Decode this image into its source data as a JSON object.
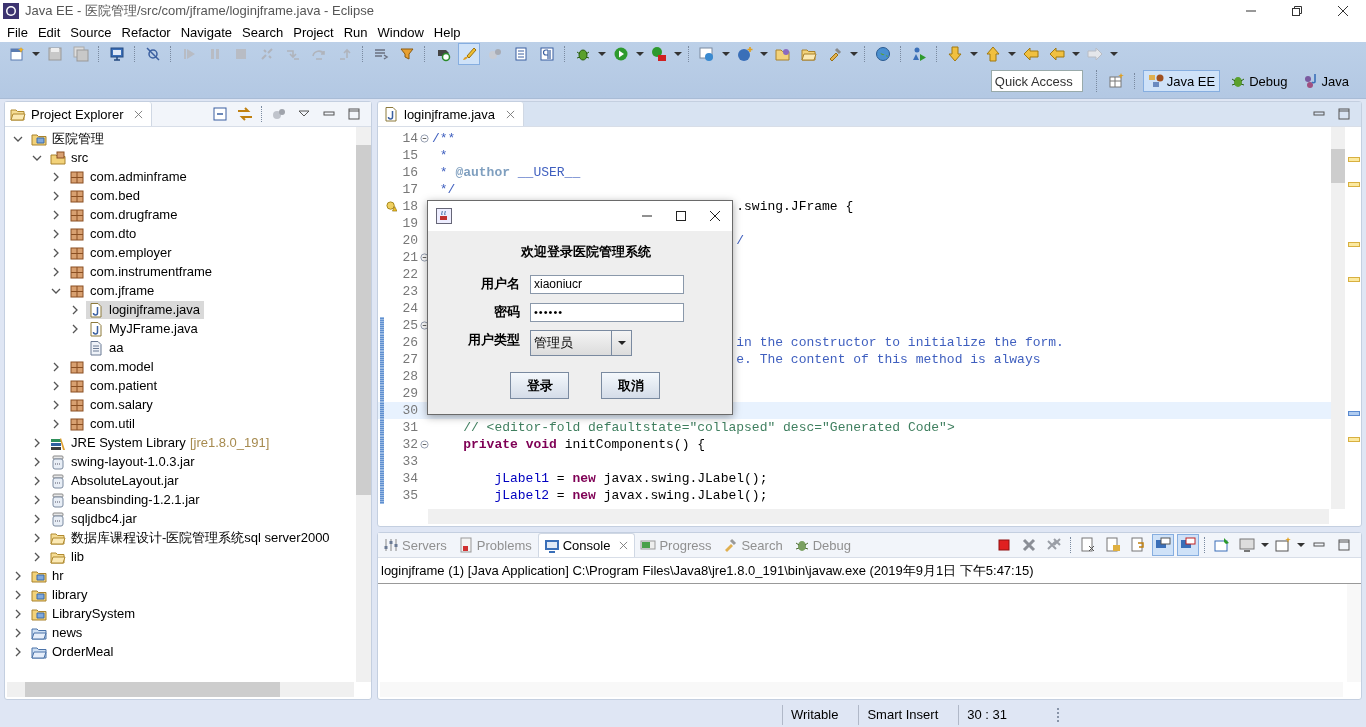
{
  "window": {
    "title": "Java EE - 医院管理/src/com/jframe/loginjframe.java - Eclipse"
  },
  "menu": [
    "File",
    "Edit",
    "Source",
    "Refactor",
    "Navigate",
    "Search",
    "Project",
    "Run",
    "Window",
    "Help"
  ],
  "main_toolbar": {
    "mark_occurrences": {
      "on": true
    }
  },
  "quick_access": {
    "placeholder": "Quick Access"
  },
  "perspectives": [
    {
      "label": "Java EE",
      "selected": true,
      "kind": "javaee"
    },
    {
      "label": "Debug",
      "selected": false,
      "kind": "debug"
    },
    {
      "label": "Java",
      "selected": false,
      "kind": "java"
    }
  ],
  "project_explorer": {
    "title": "Project Explorer",
    "tree": [
      {
        "label": "医院管理",
        "kind": "project",
        "expanded": true,
        "selected": false,
        "children": [
          {
            "label": "src",
            "kind": "source-folder",
            "expanded": true,
            "selected": false,
            "children": [
              {
                "label": "com.adminframe",
                "kind": "package",
                "expanded": false,
                "selected": false
              },
              {
                "label": "com.bed",
                "kind": "package",
                "expanded": false,
                "selected": false
              },
              {
                "label": "com.drugframe",
                "kind": "package",
                "expanded": false,
                "selected": false
              },
              {
                "label": "com.dto",
                "kind": "package",
                "expanded": false,
                "selected": false
              },
              {
                "label": "com.employer",
                "kind": "package",
                "expanded": false,
                "selected": false
              },
              {
                "label": "com.instrumentframe",
                "kind": "package",
                "expanded": false,
                "selected": false
              },
              {
                "label": "com.jframe",
                "kind": "package",
                "expanded": true,
                "selected": false,
                "children": [
                  {
                    "label": "loginjframe.java",
                    "kind": "java-file",
                    "expanded": false,
                    "selected": true
                  },
                  {
                    "label": "MyJFrame.java",
                    "kind": "java-file",
                    "expanded": false,
                    "selected": false
                  },
                  {
                    "label": "aa",
                    "kind": "text-file",
                    "selected": false
                  }
                ]
              },
              {
                "label": "com.model",
                "kind": "package",
                "expanded": false,
                "selected": false
              },
              {
                "label": "com.patient",
                "kind": "package",
                "expanded": false,
                "selected": false
              },
              {
                "label": "com.salary",
                "kind": "package",
                "expanded": false,
                "selected": false
              },
              {
                "label": "com.util",
                "kind": "package",
                "expanded": false,
                "selected": false
              }
            ]
          },
          {
            "label": "JRE System Library",
            "decoration": "[jre1.8.0_191]",
            "kind": "library",
            "expanded": false,
            "selected": false
          },
          {
            "label": "swing-layout-1.0.3.jar",
            "kind": "jar",
            "expanded": false,
            "selected": false
          },
          {
            "label": "AbsoluteLayout.jar",
            "kind": "jar",
            "expanded": false,
            "selected": false
          },
          {
            "label": "beansbinding-1.2.1.jar",
            "kind": "jar",
            "expanded": false,
            "selected": false
          },
          {
            "label": "sqljdbc4.jar",
            "kind": "jar",
            "expanded": false,
            "selected": false
          },
          {
            "label": "数据库课程设计-医院管理系统sql server2000",
            "kind": "folder",
            "expanded": false,
            "selected": false
          },
          {
            "label": "lib",
            "kind": "folder",
            "expanded": false,
            "selected": false
          }
        ]
      },
      {
        "label": "hr",
        "kind": "project",
        "expanded": false,
        "selected": false
      },
      {
        "label": "library",
        "kind": "project",
        "expanded": false,
        "selected": false
      },
      {
        "label": "LibrarySystem",
        "kind": "project",
        "expanded": false,
        "selected": false
      },
      {
        "label": "news",
        "kind": "folder-project",
        "expanded": false,
        "selected": false
      },
      {
        "label": "OrderMeal",
        "kind": "folder-project",
        "expanded": false,
        "selected": false
      }
    ]
  },
  "editor": {
    "tab": {
      "label": "loginjframe.java"
    },
    "lines": [
      {
        "number": "14",
        "fold": true,
        "changed": false,
        "current": false,
        "warning": false,
        "covered": false,
        "tokens": [
          {
            "text": "/**",
            "kind": "doc"
          }
        ]
      },
      {
        "number": "15",
        "fold": false,
        "changed": false,
        "current": false,
        "warning": false,
        "covered": false,
        "tokens": [
          {
            "text": " *",
            "kind": "doc"
          }
        ]
      },
      {
        "number": "16",
        "fold": false,
        "changed": false,
        "current": false,
        "warning": false,
        "covered": false,
        "tokens": [
          {
            "text": " * ",
            "kind": "doc"
          },
          {
            "text": "@author",
            "kind": "doctag"
          },
          {
            "text": " __USER__",
            "kind": "doc"
          }
        ]
      },
      {
        "number": "17",
        "fold": false,
        "changed": false,
        "current": false,
        "warning": false,
        "covered": false,
        "tokens": [
          {
            "text": " */",
            "kind": "doc"
          }
        ]
      },
      {
        "number": "18",
        "fold": false,
        "changed": false,
        "current": false,
        "warning": true,
        "covered": true,
        "tokens": [
          {
            "text": ".swing.JFrame {",
            "kind": "plain"
          }
        ]
      },
      {
        "number": "19",
        "fold": false,
        "changed": false,
        "current": false,
        "warning": false
      },
      {
        "number": "20",
        "fold": false,
        "changed": false,
        "current": false,
        "warning": false,
        "covered": true,
        "tokens": [
          {
            "text": "/",
            "kind": "doc"
          }
        ]
      },
      {
        "number": "21",
        "fold": true,
        "changed": false,
        "current": false,
        "warning": false
      },
      {
        "number": "22",
        "fold": false,
        "changed": false,
        "current": false,
        "warning": false
      },
      {
        "number": "23",
        "fold": false,
        "changed": false,
        "current": false,
        "warning": false
      },
      {
        "number": "24",
        "fold": false,
        "changed": false,
        "current": false,
        "warning": false
      },
      {
        "number": "25",
        "fold": true,
        "changed": true,
        "current": false,
        "warning": false
      },
      {
        "number": "26",
        "fold": false,
        "changed": true,
        "current": false,
        "warning": false,
        "covered": true,
        "tokens": [
          {
            "text": "in the constructor to initialize the form.",
            "kind": "doc"
          }
        ]
      },
      {
        "number": "27",
        "fold": false,
        "changed": true,
        "current": false,
        "warning": false,
        "covered": true,
        "tokens": [
          {
            "text": "e. The content of this method is always",
            "kind": "doc"
          }
        ]
      },
      {
        "number": "28",
        "fold": false,
        "changed": true,
        "current": false,
        "warning": false
      },
      {
        "number": "29",
        "fold": false,
        "changed": true,
        "current": false,
        "warning": false
      },
      {
        "number": "30",
        "fold": false,
        "changed": true,
        "current": true,
        "warning": false
      },
      {
        "number": "31",
        "fold": false,
        "changed": true,
        "current": false,
        "warning": false,
        "covered": false,
        "tokens": [
          {
            "text": "    // <editor-fold defaultstate=\"collapsed\" desc=\"Generated Code\">",
            "kind": "comment"
          }
        ]
      },
      {
        "number": "32",
        "fold": true,
        "changed": true,
        "current": false,
        "warning": false,
        "covered": false,
        "tokens": [
          {
            "text": "    private",
            "kind": "keyword"
          },
          {
            "text": " void",
            "kind": "keyword"
          },
          {
            "text": " initComponents() {",
            "kind": "plain"
          }
        ]
      },
      {
        "number": "33",
        "fold": false,
        "changed": true,
        "current": false,
        "warning": false
      },
      {
        "number": "34",
        "fold": false,
        "changed": true,
        "current": false,
        "warning": false,
        "covered": false,
        "tokens": [
          {
            "text": "        jLabel1",
            "kind": "field"
          },
          {
            "text": " = ",
            "kind": "plain"
          },
          {
            "text": "new",
            "kind": "keyword"
          },
          {
            "text": " javax.swing.JLabel();",
            "kind": "plain"
          }
        ]
      },
      {
        "number": "35",
        "fold": false,
        "changed": true,
        "current": false,
        "warning": false,
        "covered": false,
        "tokens": [
          {
            "text": "        jLabel2",
            "kind": "field"
          },
          {
            "text": " = ",
            "kind": "plain"
          },
          {
            "text": "new",
            "kind": "keyword"
          },
          {
            "text": " javax.swing.JLabel();",
            "kind": "plain"
          }
        ]
      }
    ]
  },
  "dialog": {
    "heading": "欢迎登录医院管理系统",
    "fields": [
      {
        "label": "用户名",
        "value": "xiaoniucr",
        "kind": "text"
      },
      {
        "label": "密码",
        "value": "••••••",
        "kind": "password"
      },
      {
        "label": "用户类型",
        "value": "管理员",
        "kind": "combo"
      }
    ],
    "buttons": [
      "登录",
      "取消"
    ]
  },
  "console": {
    "tabs": [
      {
        "label": "Servers",
        "selected": false,
        "kind": "servers"
      },
      {
        "label": "Problems",
        "selected": false,
        "kind": "problems"
      },
      {
        "label": "Console",
        "selected": true,
        "kind": "console"
      },
      {
        "label": "Progress",
        "selected": false,
        "kind": "progress"
      },
      {
        "label": "Search",
        "selected": false,
        "kind": "search"
      },
      {
        "label": "Debug",
        "selected": false,
        "kind": "debug"
      }
    ],
    "toggles": {
      "stdout": {
        "on": true
      },
      "stderr": {
        "on": true
      }
    },
    "header": "loginjframe (1) [Java Application] C:\\Program Files\\Java8\\jre1.8.0_191\\bin\\javaw.exe (2019年9月1日 下午5:47:15)"
  },
  "status_bar": [
    "Writable",
    "Smart Insert",
    "30 : 31"
  ]
}
